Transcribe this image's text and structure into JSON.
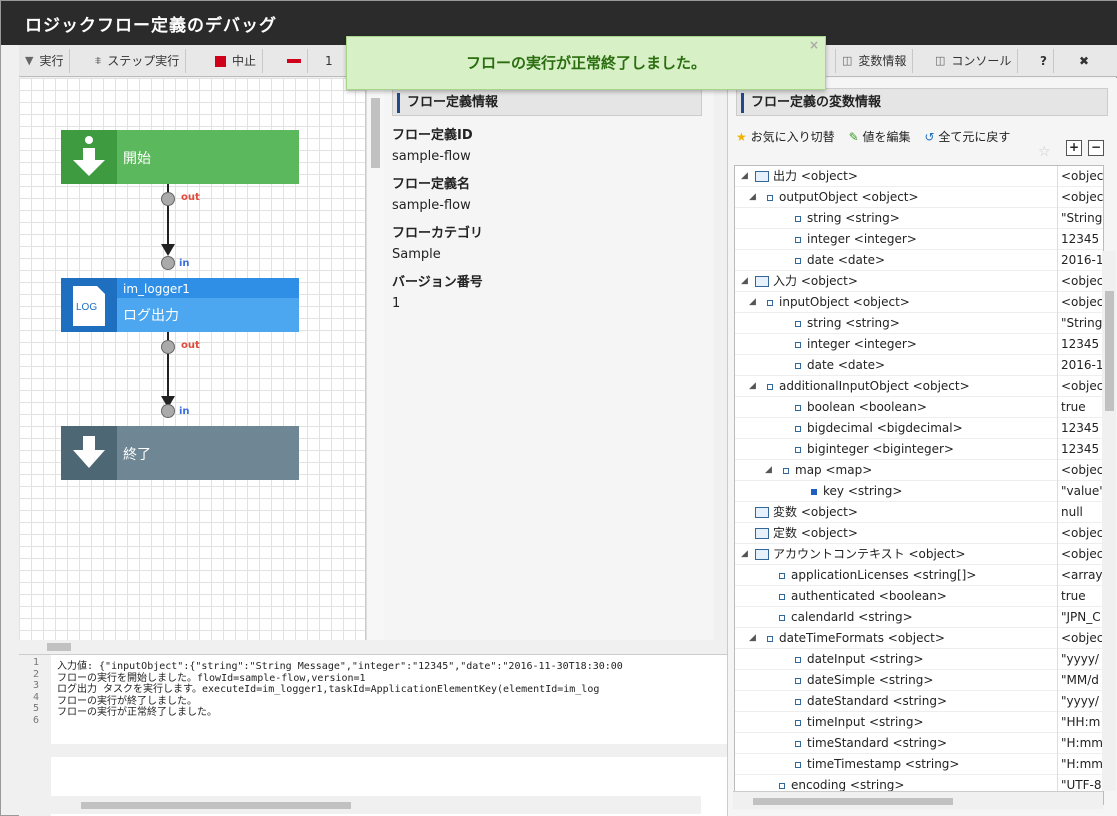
{
  "title": "ロジックフロー定義のデバッグ",
  "toolbar": {
    "run": "実行",
    "step": "ステップ実行",
    "stop": "中止",
    "collapsed_num": "1",
    "vars": "変数情報",
    "console": "コンソール",
    "help": "?",
    "close": "✖"
  },
  "toast": {
    "message": "フローの実行が正常終了しました。",
    "close": "×"
  },
  "flow": {
    "start": "開始",
    "out1": "out",
    "in1": "in",
    "task_id": "im_logger1",
    "task_icon": "LOG",
    "task_name": "ログ出力",
    "out2": "out",
    "in2": "in",
    "end": "終了"
  },
  "info": {
    "header": "フロー定義情報",
    "id_label": "フロー定義ID",
    "id_value": "sample-flow",
    "name_label": "フロー定義名",
    "name_value": "sample-flow",
    "cat_label": "フローカテゴリ",
    "cat_value": "Sample",
    "ver_label": "バージョン番号",
    "ver_value": "1"
  },
  "vars": {
    "header": "フロー定義の変数情報",
    "fav": "お気に入り切替",
    "edit": "値を編集",
    "reset": "全て元に戻す",
    "rows": [
      {
        "name": "出力 <object>",
        "val": "<objec"
      },
      {
        "name": "outputObject <object>",
        "val": "<objec"
      },
      {
        "name": "string <string>",
        "val": "\"String"
      },
      {
        "name": "integer <integer>",
        "val": "12345"
      },
      {
        "name": "date <date>",
        "val": "2016-1"
      },
      {
        "name": "入力 <object>",
        "val": "<objec"
      },
      {
        "name": "inputObject <object>",
        "val": "<objec"
      },
      {
        "name": "string <string>",
        "val": "\"String"
      },
      {
        "name": "integer <integer>",
        "val": "12345"
      },
      {
        "name": "date <date>",
        "val": "2016-1"
      },
      {
        "name": "additionalInputObject <object>",
        "val": "<objec"
      },
      {
        "name": "boolean <boolean>",
        "val": "true"
      },
      {
        "name": "bigdecimal <bigdecimal>",
        "val": "12345"
      },
      {
        "name": "biginteger <biginteger>",
        "val": "12345"
      },
      {
        "name": "map <map>",
        "val": "<objec"
      },
      {
        "name": "key <string>",
        "val": "\"value\""
      },
      {
        "name": "変数 <object>",
        "val": "null"
      },
      {
        "name": "定数 <object>",
        "val": "<objec"
      },
      {
        "name": "アカウントコンテキスト <object>",
        "val": "<objec"
      },
      {
        "name": "applicationLicenses <string[]>",
        "val": "<array"
      },
      {
        "name": "authenticated <boolean>",
        "val": "true"
      },
      {
        "name": "calendarId <string>",
        "val": "\"JPN_C"
      },
      {
        "name": "dateTimeFormats <object>",
        "val": "<objec"
      },
      {
        "name": "dateInput <string>",
        "val": "\"yyyy/"
      },
      {
        "name": "dateSimple <string>",
        "val": "\"MM/d"
      },
      {
        "name": "dateStandard <string>",
        "val": "\"yyyy/"
      },
      {
        "name": "timeInput <string>",
        "val": "\"HH:m"
      },
      {
        "name": "timeStandard <string>",
        "val": "\"H:mm"
      },
      {
        "name": "timeTimestamp <string>",
        "val": "\"H:mm"
      },
      {
        "name": "encoding <string>",
        "val": "\"UTF-8"
      }
    ]
  },
  "console": {
    "lines": [
      "入力値: {\"inputObject\":{\"string\":\"String Message\",\"integer\":\"12345\",\"date\":\"2016-11-30T18:30:00",
      "フローの実行を開始しました。flowId=sample-flow,version=1",
      "ログ出力 タスクを実行します。executeId=im_logger1,taskId=ApplicationElementKey(elementId=im_log",
      "フローの実行が終了しました。",
      "フローの実行が正常終了しました。",
      ""
    ],
    "nums": [
      "1",
      "2",
      "3",
      "4",
      "5",
      "6"
    ]
  }
}
